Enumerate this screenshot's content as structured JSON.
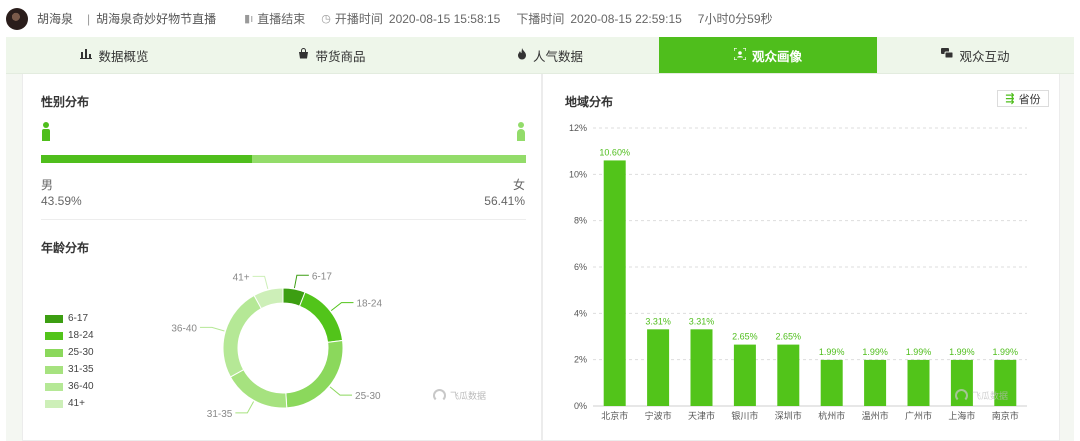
{
  "header": {
    "anchor_name": "胡海泉",
    "separator": "|",
    "room_title": "胡海泉奇妙好物节直播",
    "status_label": "直播结束",
    "start_label": "开播时间",
    "start_time": "2020-08-15 15:58:15",
    "end_label": "下播时间",
    "end_time": "2020-08-15 22:59:15",
    "duration": "7小时0分59秒"
  },
  "tabs": [
    {
      "label": "数据概览",
      "icon": "bar-chart-icon",
      "active": false
    },
    {
      "label": "带货商品",
      "icon": "shopping-bag-icon",
      "active": false
    },
    {
      "label": "人气数据",
      "icon": "flame-icon",
      "active": false
    },
    {
      "label": "观众画像",
      "icon": "portrait-scan-icon",
      "active": true
    },
    {
      "label": "观众互动",
      "icon": "chat-icon",
      "active": false
    }
  ],
  "gender": {
    "title": "性别分布",
    "male_label": "男",
    "female_label": "女",
    "male_pct": "43.59%",
    "female_pct": "56.41%",
    "male_fraction": 0.4359,
    "colors": {
      "male": "#4fbe1c",
      "female": "#93dc6a"
    }
  },
  "age": {
    "title": "年龄分布",
    "legend": [
      {
        "label": "6-17",
        "color": "#3c9e12"
      },
      {
        "label": "18-24",
        "color": "#52c41a"
      },
      {
        "label": "25-30",
        "color": "#8bd85c"
      },
      {
        "label": "31-35",
        "color": "#a6e27f"
      },
      {
        "label": "36-40",
        "color": "#b5e896"
      },
      {
        "label": "41+",
        "color": "#cdefb8"
      }
    ]
  },
  "watermark": {
    "text": "飞瓜数据"
  },
  "region": {
    "title": "地域分布",
    "toggle_label": "省份"
  },
  "chart_data": [
    {
      "type": "pie",
      "title": "年龄分布",
      "categories": [
        "6-17",
        "18-24",
        "25-30",
        "31-35",
        "36-40",
        "41+"
      ],
      "values": [
        6,
        17,
        26,
        18,
        25,
        8
      ],
      "colors": [
        "#3c9e12",
        "#52c41a",
        "#8bd85c",
        "#a6e27f",
        "#b5e896",
        "#cdefb8"
      ],
      "legend_position": "left",
      "labels_outside": true
    },
    {
      "type": "bar",
      "title": "地域分布",
      "categories": [
        "北京市",
        "宁波市",
        "天津市",
        "银川市",
        "深圳市",
        "杭州市",
        "温州市",
        "广州市",
        "上海市",
        "南京市"
      ],
      "values": [
        10.6,
        3.31,
        3.31,
        2.65,
        2.65,
        1.99,
        1.99,
        1.99,
        1.99,
        1.99
      ],
      "data_labels": [
        "10.60%",
        "3.31%",
        "3.31%",
        "2.65%",
        "2.65%",
        "1.99%",
        "1.99%",
        "1.99%",
        "1.99%",
        "1.99%"
      ],
      "ylim": [
        0,
        12
      ],
      "yticks": [
        "0%",
        "2%",
        "4%",
        "6%",
        "8%",
        "10%",
        "12%"
      ],
      "grid": true,
      "bar_color": "#52c41a"
    }
  ]
}
